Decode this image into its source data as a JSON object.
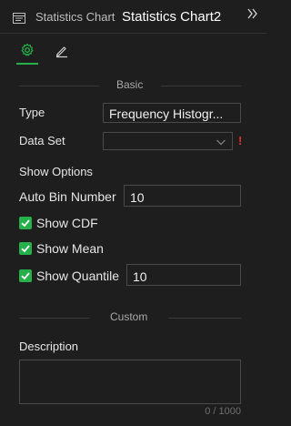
{
  "header": {
    "app_label": "Statistics Chart",
    "title": "Statistics Chart2",
    "collapse_icon": "double-chevron-right-icon"
  },
  "tabs": [
    {
      "name": "settings",
      "icon": "gear-icon",
      "active": true
    },
    {
      "name": "edit",
      "icon": "pencil-icon",
      "active": false
    }
  ],
  "colors": {
    "accent": "#25b04a",
    "required": "#e03030",
    "background": "#1e1e1e"
  },
  "basic": {
    "section_label": "Basic",
    "type": {
      "label": "Type",
      "value": "Frequency Histogr..."
    },
    "data_set": {
      "label": "Data Set",
      "value": "",
      "required_mark": "!"
    },
    "show_options_label": "Show Options",
    "auto_bin": {
      "label": "Auto Bin Number",
      "value": "10"
    },
    "show_cdf": {
      "label": "Show CDF",
      "checked": true
    },
    "show_mean": {
      "label": "Show Mean",
      "checked": true
    },
    "show_quantile": {
      "label": "Show Quantile",
      "checked": true,
      "value": "10"
    }
  },
  "custom": {
    "section_label": "Custom",
    "description": {
      "label": "Description",
      "value": "",
      "counter": "0 / 1000"
    }
  }
}
